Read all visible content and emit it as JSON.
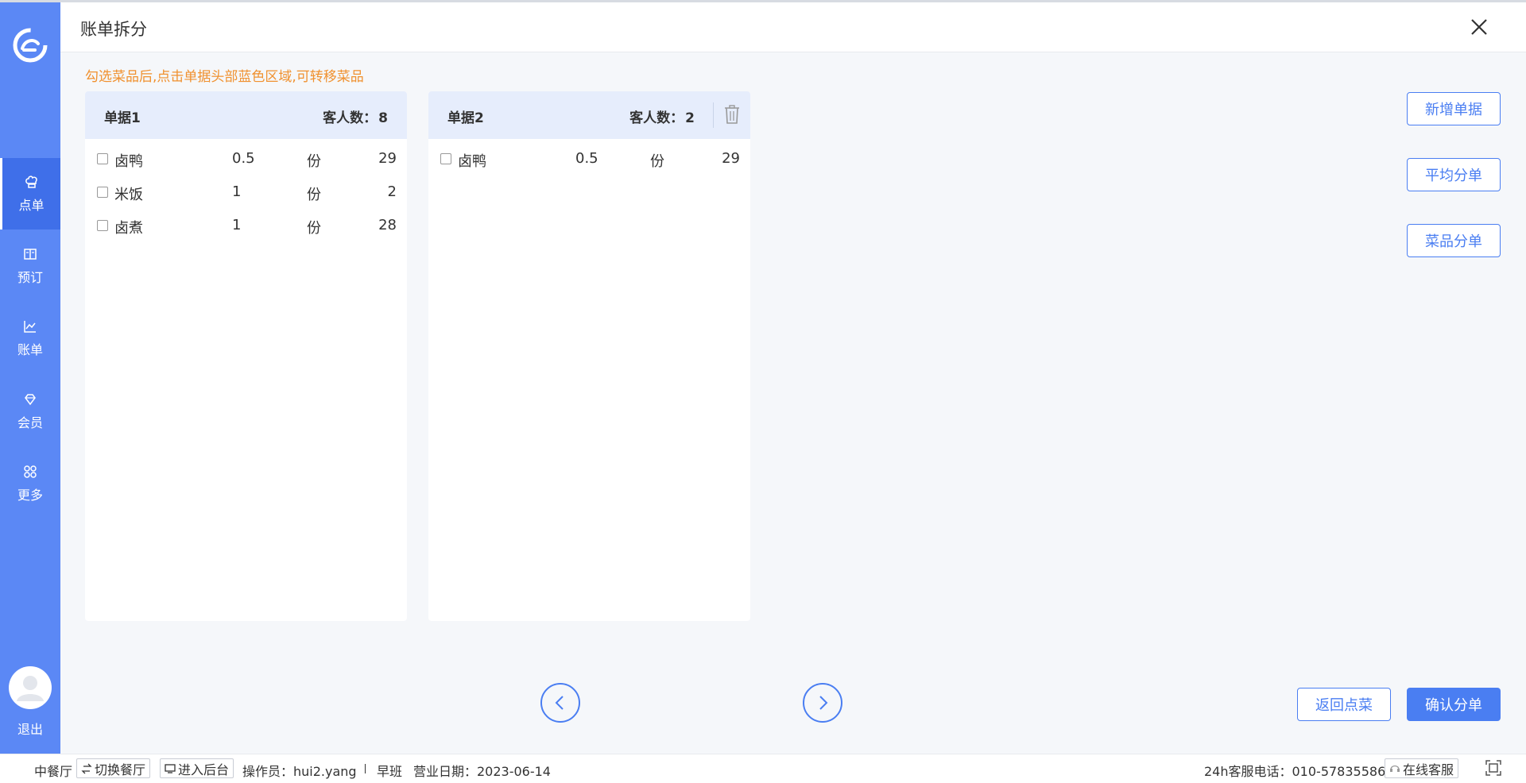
{
  "header": {
    "title": "账单拆分"
  },
  "hint": "勾选菜品后,点击单据头部蓝色区域,可转移菜品",
  "sidebar": {
    "items": [
      {
        "label": "点单",
        "icon": "chef-hat-icon",
        "active": true
      },
      {
        "label": "预订",
        "icon": "book-icon",
        "active": false
      },
      {
        "label": "账单",
        "icon": "chart-icon",
        "active": false
      },
      {
        "label": "会员",
        "icon": "diamond-icon",
        "active": false
      },
      {
        "label": "更多",
        "icon": "grid-icon",
        "active": false
      }
    ],
    "logout_label": "退出"
  },
  "bills": [
    {
      "name": "单据1",
      "guests_label": "客人数：",
      "guests": "8",
      "items": [
        {
          "name": "卤鸭",
          "qty": "0.5",
          "unit": "份",
          "price": "29"
        },
        {
          "name": "米饭",
          "qty": "1",
          "unit": "份",
          "price": "2"
        },
        {
          "name": "卤煮",
          "qty": "1",
          "unit": "份",
          "price": "28"
        }
      ]
    },
    {
      "name": "单据2",
      "guests_label": "客人数：",
      "guests": "2",
      "items": [
        {
          "name": "卤鸭",
          "qty": "0.5",
          "unit": "份",
          "price": "29"
        }
      ]
    }
  ],
  "actions": {
    "add_bill": "新增单据",
    "split_even": "平均分单",
    "split_by_item": "菜品分单",
    "back": "返回点菜",
    "confirm": "确认分单"
  },
  "footer": {
    "restaurant": "中餐厅",
    "switch_restaurant": "切换餐厅",
    "enter_backend": "进入后台",
    "operator": "操作员：hui2.yang",
    "shift": "早班",
    "business_date": "营业日期：2023-06-14",
    "hotline": "24h客服电话：010-57835586",
    "online_service": "在线客服"
  },
  "colors": {
    "sidebar": "#5b88f5",
    "sidebar_active": "#3f6fe9",
    "accent": "#4a7ef2",
    "hint": "#f0912f",
    "bill_header": "#e6edfc"
  }
}
